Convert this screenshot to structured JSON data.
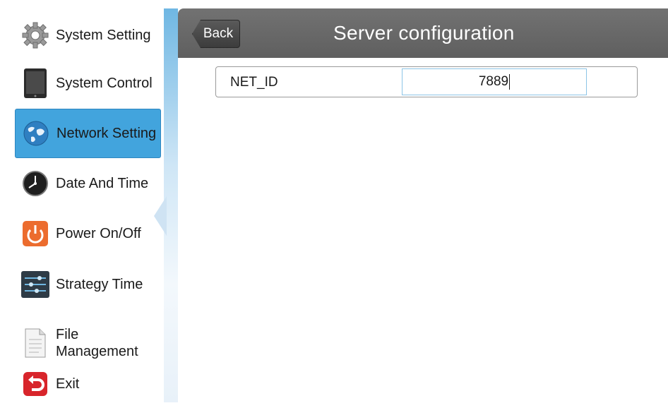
{
  "sidebar": {
    "items": [
      {
        "label": "System Setting",
        "icon": "gear-icon"
      },
      {
        "label": "System Control",
        "icon": "tablet-icon"
      },
      {
        "label": "Network Setting",
        "icon": "globe-icon",
        "active": true
      },
      {
        "label": "Date And Time",
        "icon": "clock-icon"
      },
      {
        "label": "Power On/Off",
        "icon": "power-icon"
      },
      {
        "label": "Strategy Time",
        "icon": "sliders-icon"
      },
      {
        "label": "File\nManagement",
        "icon": "document-icon"
      },
      {
        "label": "Exit",
        "icon": "exit-icon"
      }
    ]
  },
  "header": {
    "back_label": "Back",
    "title": "Server configuration"
  },
  "form": {
    "net_id_label": "NET_ID",
    "net_id_value": "7889"
  },
  "colors": {
    "active_item": "#42a4dd",
    "header_bg": "#666666",
    "input_border": "#8cc4e6"
  }
}
